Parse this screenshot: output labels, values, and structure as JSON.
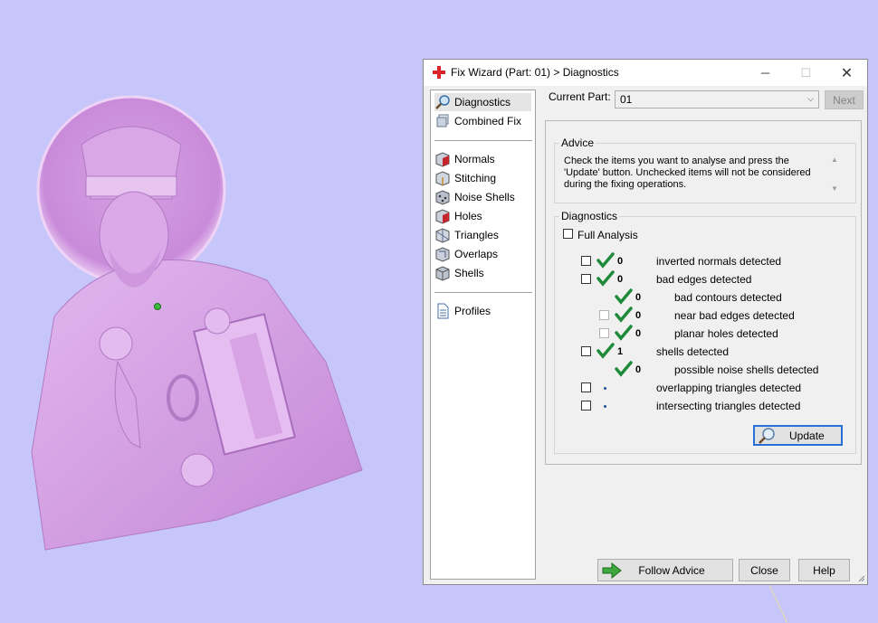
{
  "window": {
    "title": "Fix Wizard (Part: 01) > Diagnostics",
    "minimize_glyph": "─",
    "maximize_glyph": "☐",
    "close_glyph": "✕"
  },
  "nav": {
    "top": [
      {
        "label": "Diagnostics",
        "icon": "magnifier-icon"
      },
      {
        "label": "Combined Fix",
        "icon": "layers-icon"
      }
    ],
    "fixes": [
      {
        "label": "Normals",
        "icon": "normals-cube-icon"
      },
      {
        "label": "Stitching",
        "icon": "stitching-cube-icon"
      },
      {
        "label": "Noise Shells",
        "icon": "noise-cube-icon"
      },
      {
        "label": "Holes",
        "icon": "holes-cube-icon"
      },
      {
        "label": "Triangles",
        "icon": "triangles-cube-icon"
      },
      {
        "label": "Overlaps",
        "icon": "overlaps-cube-icon"
      },
      {
        "label": "Shells",
        "icon": "shells-cube-icon"
      }
    ],
    "bottom": [
      {
        "label": "Profiles",
        "icon": "document-icon"
      }
    ]
  },
  "current_part": {
    "label": "Current Part:",
    "value": "01",
    "next_label": "Next"
  },
  "advice": {
    "title": "Advice",
    "text": "Check the items you want to analyse and press the 'Update' button. Unchecked items will not be considered during the fixing operations."
  },
  "diagnostics": {
    "title": "Diagnostics",
    "full_analysis_label": "Full Analysis",
    "rows": [
      {
        "count": "0",
        "label": "inverted normals detected",
        "status": "ok"
      },
      {
        "count": "0",
        "label": "bad edges detected",
        "status": "ok"
      },
      {
        "count": "0",
        "label": "bad contours detected",
        "status": "ok"
      },
      {
        "count": "0",
        "label": "near bad edges detected",
        "status": "ok"
      },
      {
        "count": "0",
        "label": "planar holes detected",
        "status": "ok"
      },
      {
        "count": "1",
        "label": "shells detected",
        "status": "ok"
      },
      {
        "count": "0",
        "label": "possible noise shells detected",
        "status": "ok"
      },
      {
        "count": "",
        "label": "overlapping triangles detected",
        "status": "pending"
      },
      {
        "count": "",
        "label": "intersecting triangles detected",
        "status": "pending"
      }
    ],
    "update_label": "Update"
  },
  "footer": {
    "follow_advice_label": "Follow Advice",
    "close_label": "Close",
    "help_label": "Help"
  },
  "colors": {
    "viewport_bg": "#c6c6fb",
    "model": "#d9a6e6",
    "check_green": "#1f8a3a",
    "focus_blue": "#2a6fd6"
  }
}
